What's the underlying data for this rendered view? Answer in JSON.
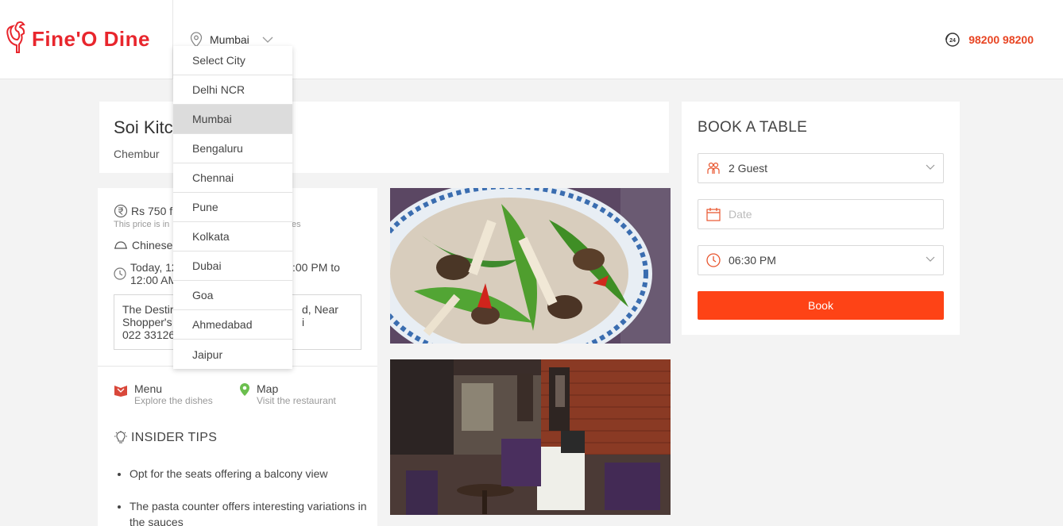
{
  "brand": {
    "name": "Fine'O Dine",
    "accent": "#e8262d"
  },
  "header": {
    "selected_city": "Mumbai",
    "phone": "98200 98200",
    "phone_icon": "24-hours-phone-icon"
  },
  "city_dropdown": {
    "items": [
      {
        "label": "Select City"
      },
      {
        "label": "Delhi NCR"
      },
      {
        "label": "Mumbai",
        "active": true
      },
      {
        "label": "Bengaluru"
      },
      {
        "label": "Chennai"
      },
      {
        "label": "Pune"
      },
      {
        "label": "Kolkata"
      },
      {
        "label": "Dubai"
      },
      {
        "label": "Goa"
      },
      {
        "label": "Ahmedabad"
      },
      {
        "label": "Jaipur"
      }
    ]
  },
  "restaurant": {
    "name_visible": "Soi Kitc",
    "area": "Chembur"
  },
  "info": {
    "price_visible": "Rs 750 f",
    "price_note_left": "This price is in",
    "price_note_right": "es",
    "cuisine_visible": "Chinese",
    "timing_line1_left": "Today, 12",
    ":00 PM to": ":00 PM to",
    "timing_line1_right": ":00 PM to",
    "timing_line2": "12:00 AM",
    "address_l1_left": "The Destir",
    "address_l1_right": "d, Near",
    "address_l2_left": "Shopper's",
    "address_l2_right": "i",
    "address_l3": "022 33126"
  },
  "links": {
    "menu_title": "Menu",
    "menu_sub": "Explore the dishes",
    "map_title": "Map",
    "map_sub": "Visit the restaurant"
  },
  "tips": {
    "heading": "INSIDER TIPS",
    "items": [
      "Opt for the seats offering a balcony view",
      "The pasta counter offers interesting variations in the sauces"
    ]
  },
  "booking": {
    "title": "BOOK A TABLE",
    "guests": "2 Guest",
    "date_placeholder": "Date",
    "time": "06:30 PM",
    "button": "Book",
    "button_color": "#fe4316"
  }
}
